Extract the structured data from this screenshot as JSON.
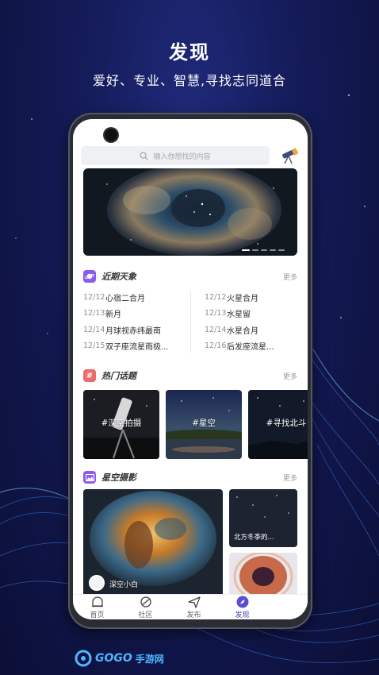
{
  "promo": {
    "title": "发现",
    "subtitle": "爱好、专业、智慧,寻找志同道合"
  },
  "search": {
    "placeholder": "输入你想找的内容",
    "icon": "search-icon",
    "scope_icon": "telescope-icon"
  },
  "banner": {
    "image": "rosette-nebula",
    "page_dots": 5,
    "active_dot": 1
  },
  "sections": {
    "events": {
      "title": "近期天象",
      "more": "更多",
      "icon": "planet-icon",
      "icon_color": "#8c5cf0"
    },
    "topics": {
      "title": "热门话题",
      "more": "更多",
      "icon": "hashtag-icon",
      "icon_color": "#f06a6a"
    },
    "photos": {
      "title": "星空摄影",
      "more": "更多",
      "icon": "picture-icon",
      "icon_color": "#8e5bf0"
    }
  },
  "events_left": [
    {
      "date": "12/12",
      "name": "心宿二合月"
    },
    {
      "date": "12/13",
      "name": "新月"
    },
    {
      "date": "12/14",
      "name": "月球视赤纬最南"
    },
    {
      "date": "12/15",
      "name": "双子座流星雨极..."
    }
  ],
  "events_right": [
    {
      "date": "12/12",
      "name": "火星合月"
    },
    {
      "date": "12/13",
      "name": "水星留"
    },
    {
      "date": "12/14",
      "name": "水星合月"
    },
    {
      "date": "12/16",
      "name": "后发座流星..."
    }
  ],
  "topics": [
    {
      "label": "#深空拍摄"
    },
    {
      "label": "#星空"
    },
    {
      "label": "#寻找北斗"
    }
  ],
  "photos": {
    "big_author": "深空小白",
    "small_caption": "北方冬季的..."
  },
  "tabbar": [
    {
      "label": "首页",
      "icon": "home-icon",
      "active": false
    },
    {
      "label": "社区",
      "icon": "planet-ring-icon",
      "active": false
    },
    {
      "label": "发布",
      "icon": "paper-plane-icon",
      "active": false
    },
    {
      "label": "发现",
      "icon": "compass-icon",
      "active": true
    }
  ],
  "watermark": {
    "brand": "GOGO",
    "suffix": "手游网"
  }
}
